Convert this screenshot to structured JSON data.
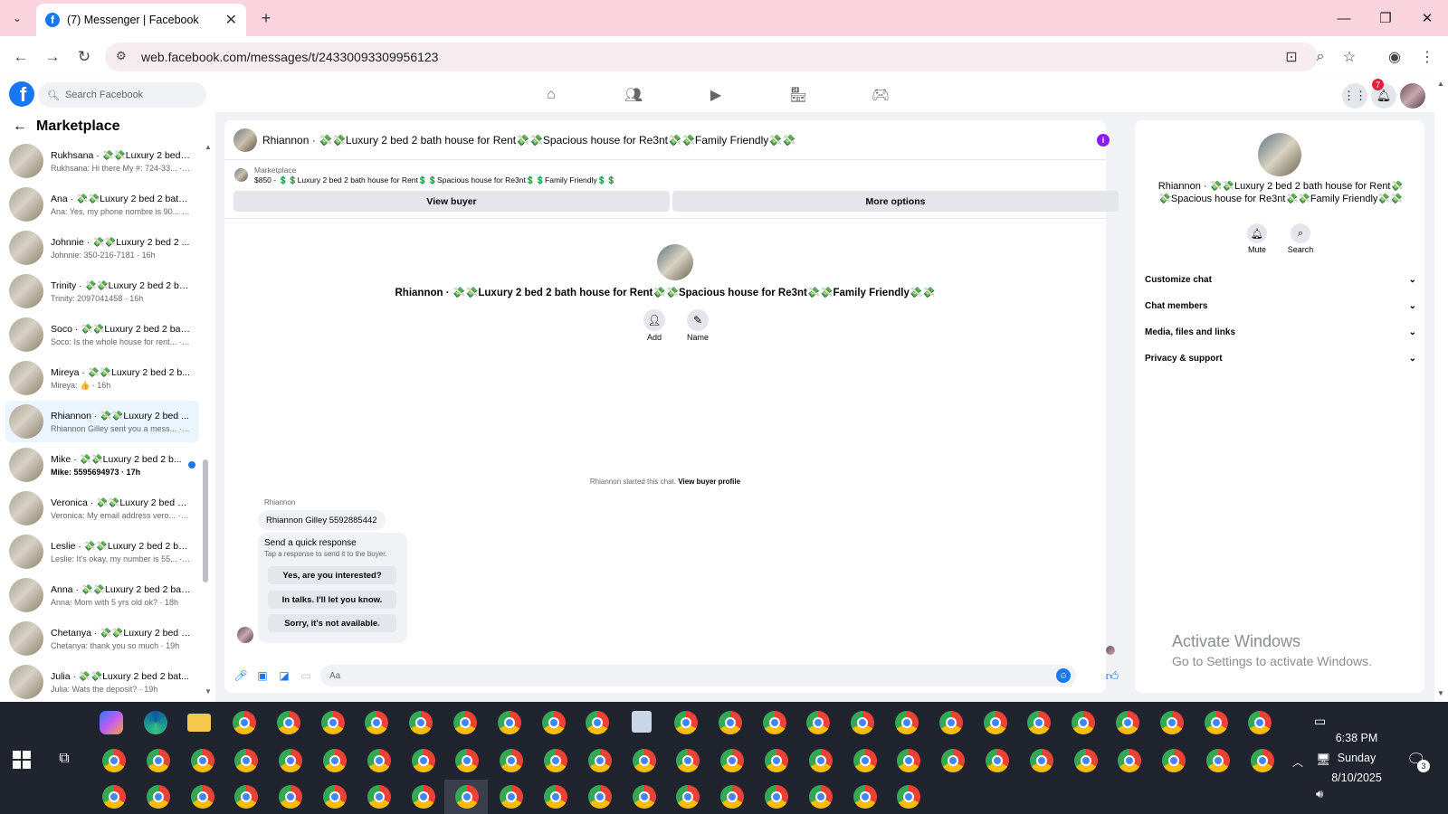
{
  "browser": {
    "tab_title": "(7) Messenger | Facebook",
    "url": "web.facebook.com/messages/t/24330093309956123"
  },
  "fb": {
    "search_placeholder": "Search Facebook",
    "notif_count": "7",
    "brand_color": "#1877f2"
  },
  "sidebar": {
    "title": "Marketplace",
    "conversations": [
      {
        "name": "Rukhsana · 💸💸Luxury 2 bed ...",
        "preview": "Rukhsana: Hi there My #: 724-33... · 16h",
        "active": false,
        "unread": false
      },
      {
        "name": "Ana · 💸💸Luxury 2 bed 2 bath...",
        "preview": "Ana: Yes, my phone nombre is 90... · 16h",
        "active": false,
        "unread": false
      },
      {
        "name": "Johnnie · 💸💸Luxury 2 bed 2 ...",
        "preview": "Johnnie: 350-216-7181 · 16h",
        "active": false,
        "unread": false
      },
      {
        "name": "Trinity · 💸💸Luxury 2 bed 2 ba...",
        "preview": "Trinity: 2097041458 · 16h",
        "active": false,
        "unread": false
      },
      {
        "name": "Soco · 💸💸Luxury 2 bed 2 bat...",
        "preview": "Soco: Is the whole house for rent... · 16h",
        "active": false,
        "unread": false
      },
      {
        "name": "Mireya · 💸💸Luxury 2 bed 2 b...",
        "preview": "Mireya: 👍 · 16h",
        "active": false,
        "unread": false
      },
      {
        "name": "Rhiannon · 💸💸Luxury 2 bed ...",
        "preview": "Rhiannon Gilley sent you a mess... · 17h",
        "active": true,
        "unread": false
      },
      {
        "name": "Mike · 💸💸Luxury 2 bed 2 b...",
        "preview": "Mike: 5595694973 · 17h",
        "active": false,
        "unread": true
      },
      {
        "name": "Veronica · 💸💸Luxury 2 bed 2 ...",
        "preview": "Veronica: My email address vero... · 18h",
        "active": false,
        "unread": false
      },
      {
        "name": "Leslie · 💸💸Luxury 2 bed 2 bat...",
        "preview": "Leslie: It's okay, my number is 55... · 18h",
        "active": false,
        "unread": false
      },
      {
        "name": "Anna · 💸💸Luxury 2 bed 2 bat...",
        "preview": "Anna: Mom with 5 yrs old ok? · 18h",
        "active": false,
        "unread": false
      },
      {
        "name": "Chetanya · 💸💸Luxury 2 bed 2...",
        "preview": "Chetanya: thank you so much · 19h",
        "active": false,
        "unread": false
      },
      {
        "name": "Julia · 💸💸Luxury 2 bed 2 bat...",
        "preview": "Julia: Wats the deposit? · 19h",
        "active": false,
        "unread": false
      }
    ]
  },
  "chat": {
    "header_title": "Rhiannon · 💸💸Luxury 2 bed 2 bath house for Rent💸💸Spacious house for Re3nt💸💸Family Friendly💸💸",
    "marketplace_label": "Marketplace",
    "listing_line": "$850 - 💲💲Luxury 2 bed 2 bath house for Rent💲💲Spacious house for Re3nt💲💲Family Friendly💲💲",
    "view_buyer": "View buyer",
    "more_options": "More options",
    "center_title": "Rhiannon · 💸💸Luxury 2 bed 2 bath house for Rent💸💸Spacious house for Re3nt💸💸Family Friendly💸💸",
    "add_label": "Add",
    "name_label": "Name",
    "started_text": "Rhiannon started this chat.",
    "view_profile": "View buyer profile",
    "sender": "Rhiannon",
    "message": "Rhiannon Gilley 5592885442",
    "quick_title": "Send a quick response",
    "quick_sub": "Tap a response to send it to the buyer.",
    "quick_responses": [
      "Yes, are you interested?",
      "In talks. I'll let you know.",
      "Sorry, it's not available."
    ],
    "compose_placeholder": "Aa"
  },
  "rightpanel": {
    "title_line1": "Rhiannon · 💸💸Luxury 2 bed 2 bath house for Rent💸",
    "title_line2": "💸Spacious house for Re3nt💸💸Family Friendly💸💸",
    "mute": "Mute",
    "search": "Search",
    "rows": [
      "Customize chat",
      "Chat members",
      "Media, files and links",
      "Privacy & support"
    ]
  },
  "watermark": {
    "line1": "Activate Windows",
    "line2": "Go to Settings to activate Windows."
  },
  "taskbar": {
    "time": "6:38 PM",
    "day": "Sunday",
    "date": "8/10/2025",
    "notif_count": "3"
  }
}
